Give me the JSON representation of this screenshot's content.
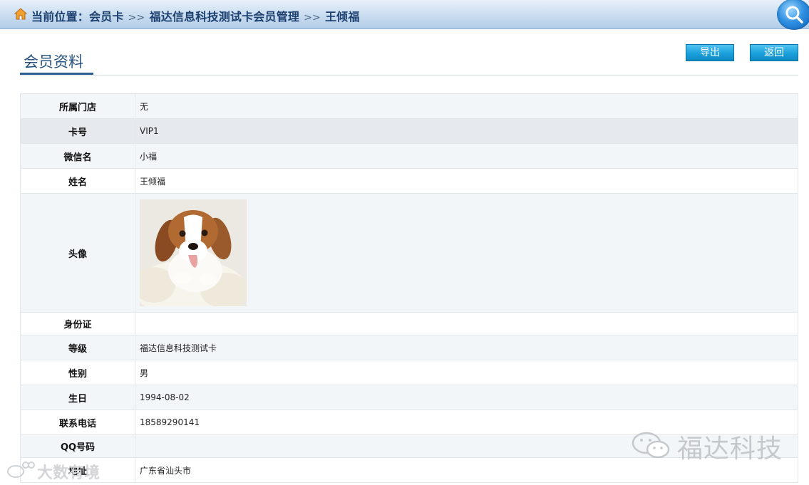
{
  "breadcrumb": {
    "prefix": "当前位置：",
    "items": [
      "会员卡",
      "福达信息科技测试卡会员管理",
      "王倾福"
    ],
    "separator": ">>"
  },
  "header": {
    "title": "会员资料",
    "export_label": "导出",
    "back_label": "返回"
  },
  "details": {
    "rows": [
      {
        "label": "所属门店",
        "value": "无"
      },
      {
        "label": "卡号",
        "value": "VIP1"
      },
      {
        "label": "微信名",
        "value": "小福"
      },
      {
        "label": "姓名",
        "value": "王倾福"
      },
      {
        "label": "头像",
        "value": ""
      },
      {
        "label": "身份证",
        "value": ""
      },
      {
        "label": "等级",
        "value": "福达信息科技测试卡"
      },
      {
        "label": "性别",
        "value": "男"
      },
      {
        "label": "生日",
        "value": "1994-08-02"
      },
      {
        "label": "联系电话",
        "value": "18589290141"
      },
      {
        "label": "QQ号码",
        "value": ""
      },
      {
        "label": "地址",
        "value": "广东省汕头市"
      }
    ]
  },
  "watermarks": {
    "right": "福达科技",
    "left": "大数有境"
  },
  "colors": {
    "title": "#27537f",
    "button": "#1aa0dc",
    "breadcrumb": "#1b3f6e"
  },
  "icons": {
    "home": "home-icon",
    "search": "search-icon",
    "avatar": "dog-photo"
  }
}
